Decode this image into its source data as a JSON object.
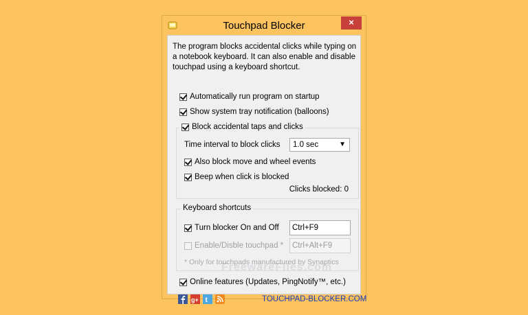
{
  "window": {
    "title": "Touchpad Blocker",
    "close_label": "×"
  },
  "description": "The program blocks accidental clicks while typing on a notebook keyboard. It can also enable and disable touchpad using a keyboard shortcut.",
  "options": {
    "autorun": {
      "label": "Automatically run program on startup",
      "checked": true
    },
    "tray_notification": {
      "label": "Show system tray notification (balloons)",
      "checked": true
    }
  },
  "block_group": {
    "label": "Block accidental taps and clicks",
    "checked": true,
    "interval_label": "Time interval to block clicks",
    "interval_value": "1.0 sec",
    "move_wheel": {
      "label": "Also block move and wheel events",
      "checked": true
    },
    "beep": {
      "label": "Beep when click is blocked",
      "checked": true
    },
    "clicks_blocked": "Clicks blocked: 0"
  },
  "shortcuts": {
    "title": "Keyboard shortcuts",
    "blocker_toggle": {
      "label": "Turn blocker On and Off",
      "checked": true,
      "value": "Ctrl+F9"
    },
    "touchpad_toggle": {
      "label": "Enable/Disble touchpad *",
      "checked": false,
      "value": "Ctrl+Alt+F9"
    },
    "note": "* Only for touchpads manufactured by Synaptics"
  },
  "watermark": "FreewareFiles.com",
  "online_features": {
    "label": "Online features (Updates, PingNotify™, etc.)",
    "checked": true
  },
  "social_icons": [
    "facebook-icon",
    "google-plus-icon",
    "twitter-icon",
    "rss-icon"
  ],
  "website_link": "TOUCHPAD-BLOCKER.COM",
  "colors": {
    "background": "#fdc35f",
    "close_button": "#c7403a",
    "link": "#1a3dbd"
  }
}
